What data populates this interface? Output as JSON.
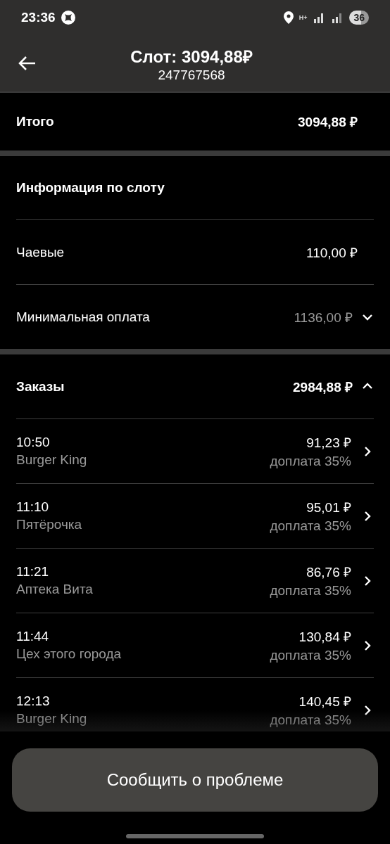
{
  "status_bar": {
    "time": "23:36",
    "network": "H+",
    "battery": "36"
  },
  "header": {
    "title": "Слот: 3094,88₽",
    "subtitle": "247767568"
  },
  "total": {
    "label": "Итого",
    "amount": "3094,88 ₽"
  },
  "info": {
    "title": "Информация по слоту",
    "rows": [
      {
        "kind": "plain",
        "label": "Чаевые",
        "amount": "110,00 ₽",
        "muted": false
      },
      {
        "kind": "collapsible",
        "label": "Минимальная оплата",
        "amount": "1136,00 ₽",
        "muted": true,
        "expanded": false
      }
    ]
  },
  "orders": {
    "label": "Заказы",
    "amount": "2984,88 ₽",
    "expanded": true,
    "items": [
      {
        "time": "10:50",
        "place": "Burger King",
        "amount": "91,23 ₽",
        "note": "доплата 35%"
      },
      {
        "time": "11:10",
        "place": "Пятёрочка",
        "amount": "95,01 ₽",
        "note": "доплата 35%"
      },
      {
        "time": "11:21",
        "place": "Аптека Вита",
        "amount": "86,76 ₽",
        "note": "доплата 35%"
      },
      {
        "time": "11:44",
        "place": "Цех этого города",
        "amount": "130,84 ₽",
        "note": "доплата 35%"
      },
      {
        "time": "12:13",
        "place": "Burger King",
        "amount": "140,45 ₽",
        "note": "доплата 35%"
      }
    ]
  },
  "report_button": "Сообщить о проблеме"
}
